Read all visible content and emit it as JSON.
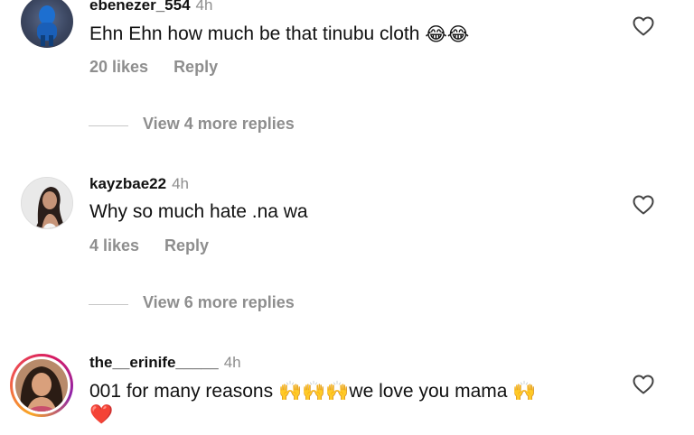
{
  "comments": [
    {
      "username": "ebenezer_554",
      "time": "4h",
      "text": "Ehn Ehn how much be that tinubu cloth",
      "emoji": "😂😂",
      "likes": "20 likes",
      "reply": "Reply",
      "view_more": "View 4 more replies"
    },
    {
      "username": "kayzbae22",
      "time": "4h",
      "text": "Why so much hate .na wa",
      "likes": "4 likes",
      "reply": "Reply",
      "view_more": "View 6 more replies"
    },
    {
      "username": "the__erinife_____",
      "time": "4h",
      "text_a": "001 for many reasons ",
      "emoji_a": "🙌🙌🙌",
      "text_b": "we love you mama ",
      "emoji_b": "🙌",
      "emoji_line2": "❤️"
    }
  ],
  "colors": {
    "muted": "#8e8e8e",
    "story_ring": "#e1306c"
  }
}
